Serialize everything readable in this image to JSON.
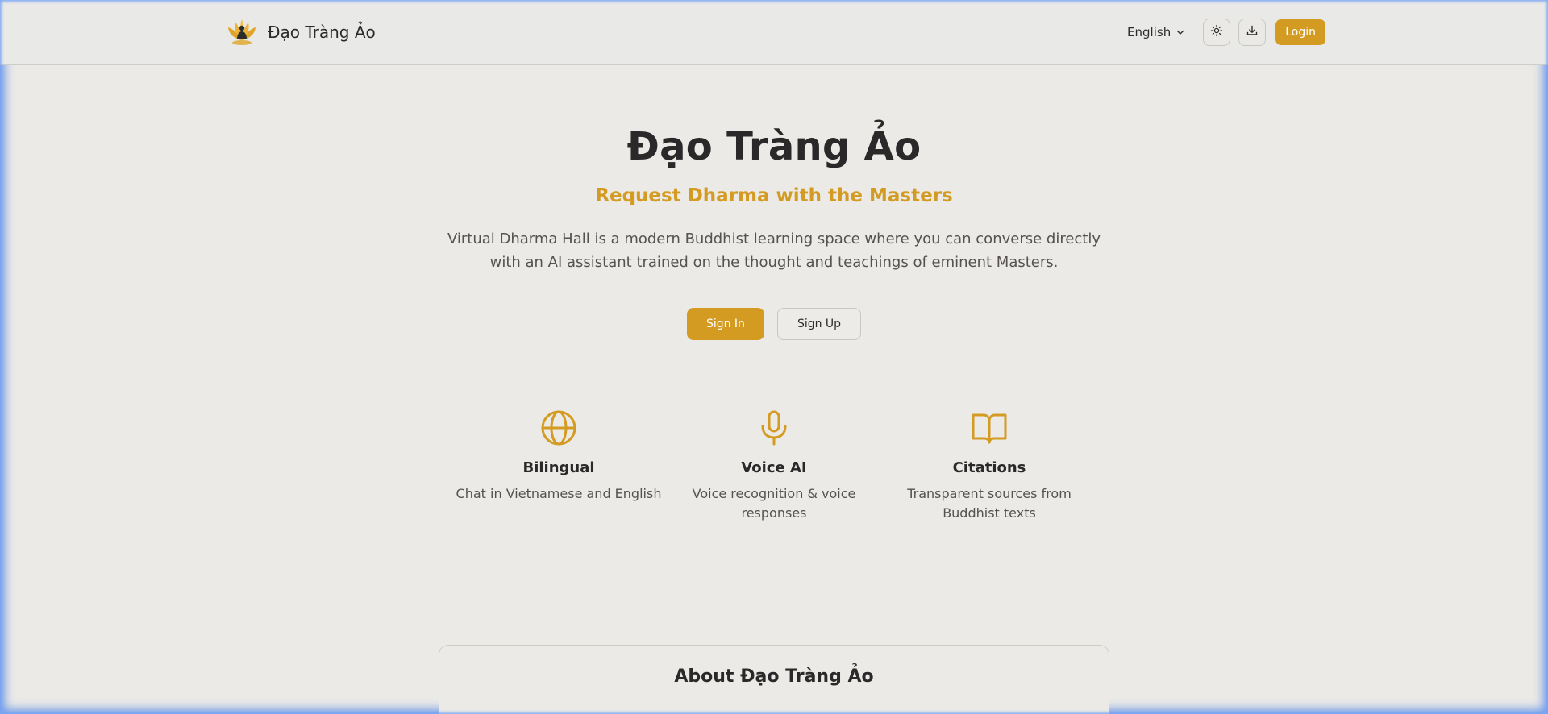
{
  "header": {
    "brand_name": "Đạo Tràng Ảo",
    "language": "English",
    "login_label": "Login"
  },
  "hero": {
    "title": "Đạo Tràng Ảo",
    "subtitle": "Request Dharma with the Masters",
    "description": "Virtual Dharma Hall is a modern Buddhist learning space where you can converse directly with an AI assistant trained on the thought and teachings of eminent Masters.",
    "sign_in_label": "Sign In",
    "sign_up_label": "Sign Up"
  },
  "features": [
    {
      "icon": "globe-icon",
      "title": "Bilingual",
      "description": "Chat in Vietnamese and English"
    },
    {
      "icon": "microphone-icon",
      "title": "Voice AI",
      "description": "Voice recognition & voice responses"
    },
    {
      "icon": "book-open-icon",
      "title": "Citations",
      "description": "Transparent sources from Buddhist texts"
    }
  ],
  "about": {
    "title": "About Đạo Tràng Ảo"
  },
  "colors": {
    "accent": "#d49b22",
    "background": "#ebeae6",
    "text": "#2a2828",
    "muted_text": "#555250"
  }
}
